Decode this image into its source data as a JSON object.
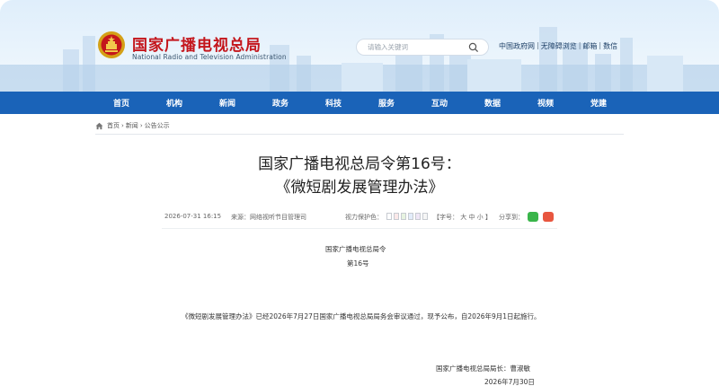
{
  "header": {
    "title": "国家广播电视总局",
    "subtitle": "National Radio and Television Administration",
    "search_placeholder": "请输入关键词",
    "top_links": [
      "中国政府网",
      "无障碍浏览",
      "邮箱",
      "数信"
    ],
    "emblem_icon": "national-emblem-icon"
  },
  "nav": {
    "items": [
      "首页",
      "机构",
      "新闻",
      "政务",
      "科技",
      "服务",
      "互动",
      "数据",
      "视频",
      "党建"
    ]
  },
  "breadcrumb": {
    "items": [
      "首页",
      "新闻",
      "公告公示"
    ]
  },
  "article": {
    "title_line1": "国家广播电视总局令第16号：",
    "title_line2": "《微短剧发展管理办法》",
    "meta": {
      "datetime": "2026-07-31 16:15",
      "source": "来源：网络视听节目管理司",
      "color_label": "视力保护色：",
      "font_size": "【字号： 大 中 小 】",
      "share_label": "分享到："
    },
    "order_title": "国家广播电视总局令",
    "order_number": "第16号",
    "body": "《微短剧发展管理办法》已经2026年7月27日国家广播电视总局局务会审议通过，现予公布，自2026年9月1日起施行。",
    "signature": "国家广播电视总局局长：曹淑敏",
    "date": "2026年7月30日"
  },
  "colors": {
    "nav_blue": "#1a63b8",
    "title_red": "#c4161c",
    "swatches": [
      "#ffffff",
      "#fbe8e8",
      "#e7f3e0",
      "#e2ecfa",
      "#efe6f6",
      "#f6f6f6"
    ]
  }
}
